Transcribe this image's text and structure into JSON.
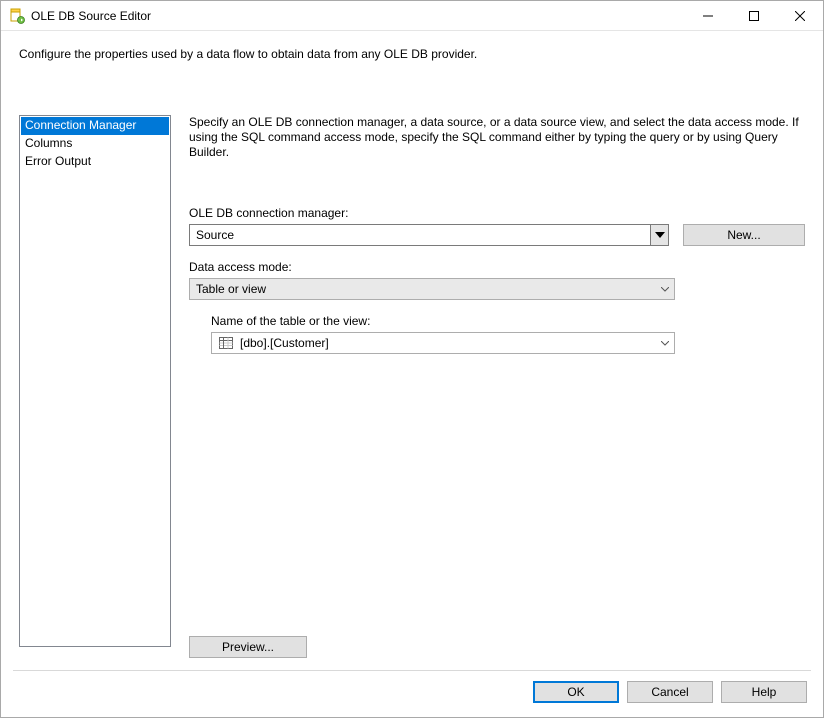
{
  "window": {
    "title": "OLE DB Source Editor"
  },
  "description": "Configure the properties used by a data flow to obtain data from any OLE DB provider.",
  "sidebar": {
    "items": [
      {
        "label": "Connection Manager",
        "selected": true
      },
      {
        "label": "Columns",
        "selected": false
      },
      {
        "label": "Error Output",
        "selected": false
      }
    ]
  },
  "main": {
    "instruction": "Specify an OLE DB connection manager, a data source, or a data source view, and select the data access mode. If using the SQL command access mode, specify the SQL command either by typing the query or by using Query Builder.",
    "conn_label": "OLE DB connection manager:",
    "conn_value": "Source",
    "new_button": "New...",
    "mode_label": "Data access mode:",
    "mode_value": "Table or view",
    "table_label": "Name of the table or the view:",
    "table_value": "[dbo].[Customer]",
    "preview_button": "Preview..."
  },
  "footer": {
    "ok": "OK",
    "cancel": "Cancel",
    "help": "Help"
  }
}
